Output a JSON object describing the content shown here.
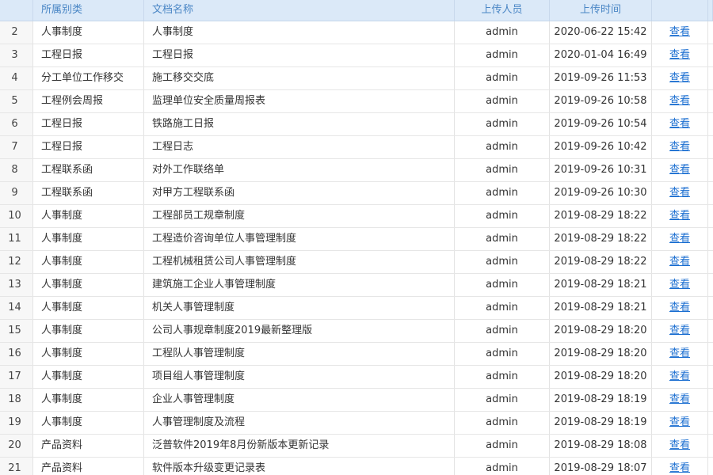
{
  "columns": {
    "number": "",
    "category": "所属别类",
    "name": "文档名称",
    "uploader": "上传人员",
    "time": "上传时间",
    "action": ""
  },
  "rows": [
    {
      "number": "2",
      "category": "人事制度",
      "name": "人事制度",
      "uploader": "admin",
      "time": "2020-06-22 15:42",
      "action": "查看"
    },
    {
      "number": "3",
      "category": "工程日报",
      "name": "工程日报",
      "uploader": "admin",
      "time": "2020-01-04 16:49",
      "action": "查看"
    },
    {
      "number": "4",
      "category": "分工单位工作移交",
      "name": "施工移交交底",
      "uploader": "admin",
      "time": "2019-09-26 11:53",
      "action": "查看"
    },
    {
      "number": "5",
      "category": "工程例会周报",
      "name": "监理单位安全质量周报表",
      "uploader": "admin",
      "time": "2019-09-26 10:58",
      "action": "查看"
    },
    {
      "number": "6",
      "category": "工程日报",
      "name": "铁路施工日报",
      "uploader": "admin",
      "time": "2019-09-26 10:54",
      "action": "查看"
    },
    {
      "number": "7",
      "category": "工程日报",
      "name": "工程日志",
      "uploader": "admin",
      "time": "2019-09-26 10:42",
      "action": "查看"
    },
    {
      "number": "8",
      "category": "工程联系函",
      "name": "对外工作联络单",
      "uploader": "admin",
      "time": "2019-09-26 10:31",
      "action": "查看"
    },
    {
      "number": "9",
      "category": "工程联系函",
      "name": "对甲方工程联系函",
      "uploader": "admin",
      "time": "2019-09-26 10:30",
      "action": "查看"
    },
    {
      "number": "10",
      "category": "人事制度",
      "name": "工程部员工规章制度",
      "uploader": "admin",
      "time": "2019-08-29 18:22",
      "action": "查看"
    },
    {
      "number": "11",
      "category": "人事制度",
      "name": "工程造价咨询单位人事管理制度",
      "uploader": "admin",
      "time": "2019-08-29 18:22",
      "action": "查看"
    },
    {
      "number": "12",
      "category": "人事制度",
      "name": "工程机械租赁公司人事管理制度",
      "uploader": "admin",
      "time": "2019-08-29 18:22",
      "action": "查看"
    },
    {
      "number": "13",
      "category": "人事制度",
      "name": "建筑施工企业人事管理制度",
      "uploader": "admin",
      "time": "2019-08-29 18:21",
      "action": "查看"
    },
    {
      "number": "14",
      "category": "人事制度",
      "name": "机关人事管理制度",
      "uploader": "admin",
      "time": "2019-08-29 18:21",
      "action": "查看"
    },
    {
      "number": "15",
      "category": "人事制度",
      "name": "公司人事规章制度2019最新整理版",
      "uploader": "admin",
      "time": "2019-08-29 18:20",
      "action": "查看"
    },
    {
      "number": "16",
      "category": "人事制度",
      "name": "工程队人事管理制度",
      "uploader": "admin",
      "time": "2019-08-29 18:20",
      "action": "查看"
    },
    {
      "number": "17",
      "category": "人事制度",
      "name": "项目组人事管理制度",
      "uploader": "admin",
      "time": "2019-08-29 18:20",
      "action": "查看"
    },
    {
      "number": "18",
      "category": "人事制度",
      "name": "企业人事管理制度",
      "uploader": "admin",
      "time": "2019-08-29 18:19",
      "action": "查看"
    },
    {
      "number": "19",
      "category": "人事制度",
      "name": "人事管理制度及流程",
      "uploader": "admin",
      "time": "2019-08-29 18:19",
      "action": "查看"
    },
    {
      "number": "20",
      "category": "产品资料",
      "name": "泛普软件2019年8月份新版本更新记录",
      "uploader": "admin",
      "time": "2019-08-29 18:08",
      "action": "查看"
    },
    {
      "number": "21",
      "category": "产品资料",
      "name": "软件版本升级变更记录表",
      "uploader": "admin",
      "time": "2019-08-29 18:07",
      "action": "查看"
    }
  ],
  "colors": {
    "header_bg": "#dbe9f8",
    "header_text": "#4a86c5",
    "link": "#1c6fd1"
  }
}
